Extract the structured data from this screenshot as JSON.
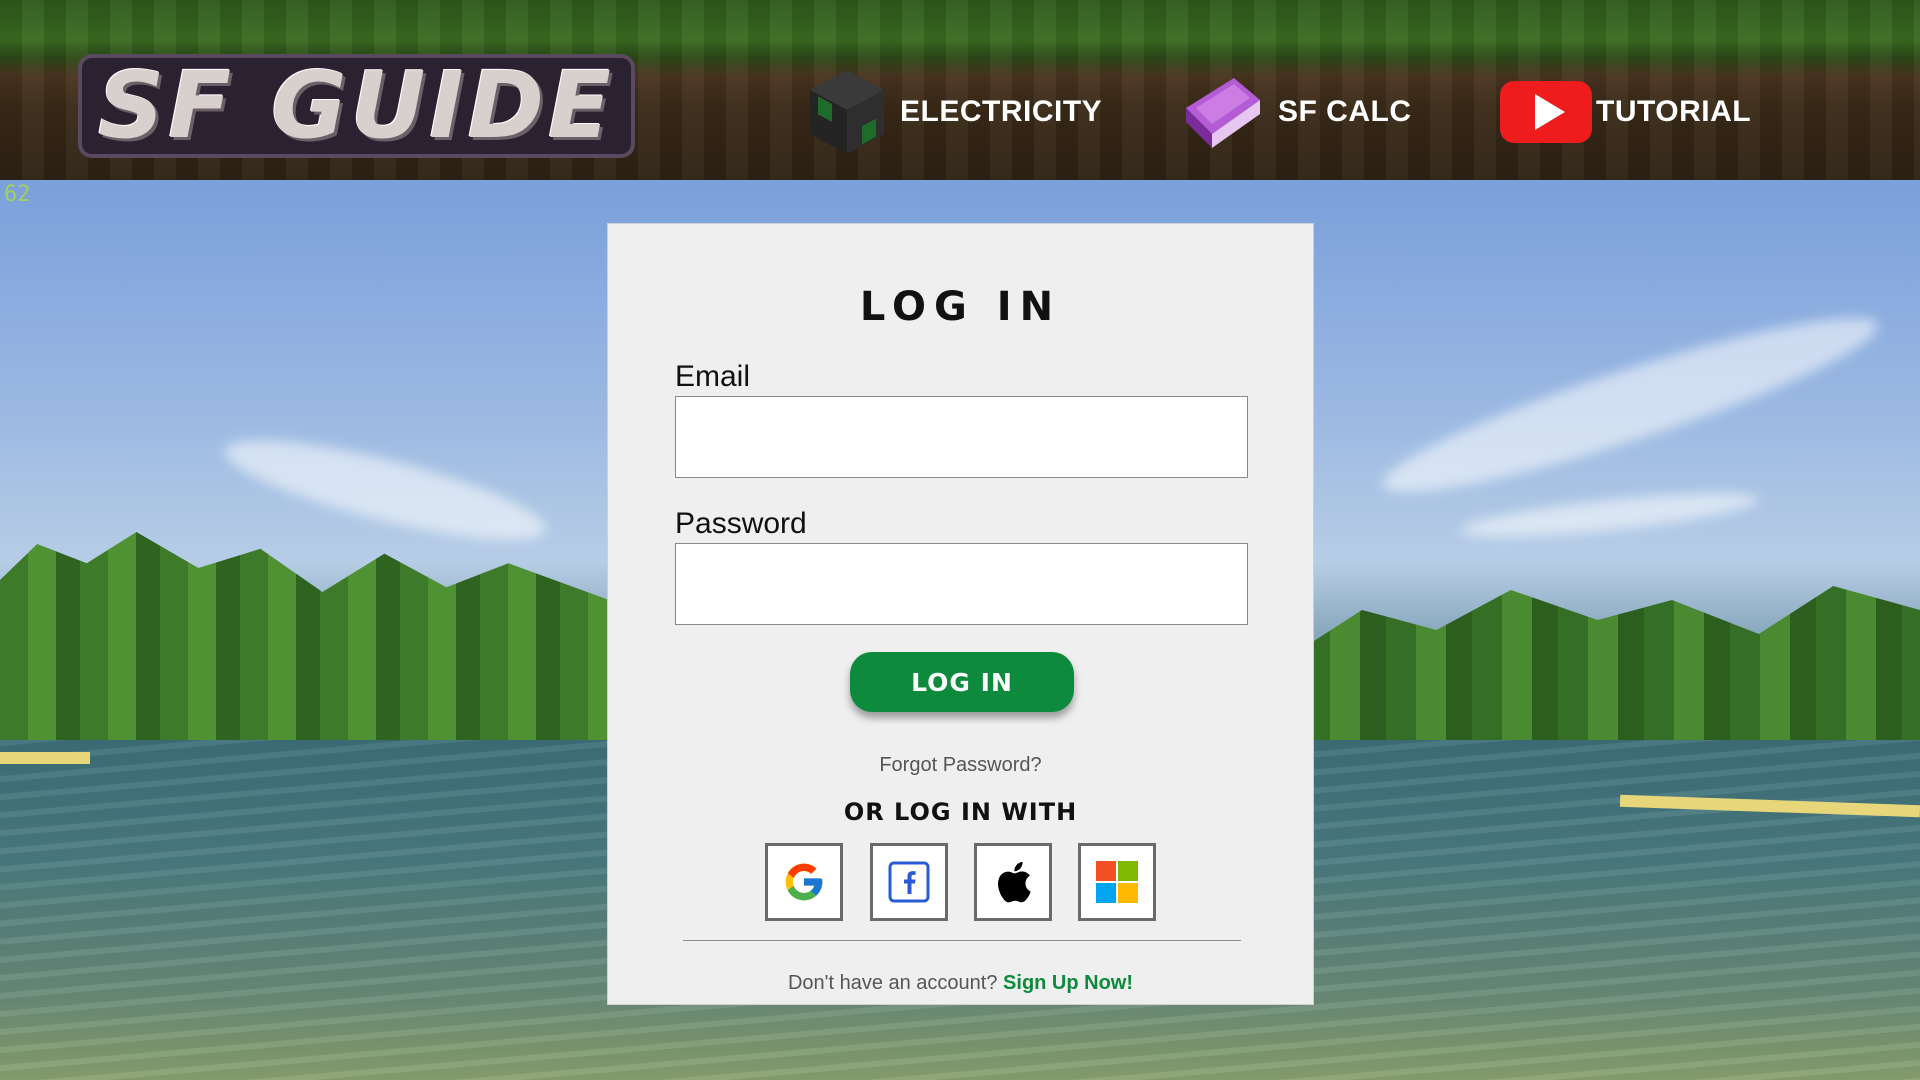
{
  "header": {
    "logo_text": "SF GUIDE",
    "nav": [
      {
        "label": "ELECTRICITY",
        "icon": "machine-block-icon"
      },
      {
        "label": "SF CALC",
        "icon": "enchanted-book-icon"
      },
      {
        "label": "TUTORIAL",
        "icon": "youtube-icon"
      }
    ]
  },
  "fps_counter": "62",
  "login": {
    "title": "LOG IN",
    "email_label": "Email",
    "email_value": "",
    "password_label": "Password",
    "password_value": "",
    "submit_label": "LOG IN",
    "forgot_label": "Forgot Password?",
    "or_label": "OR LOG IN WITH",
    "providers": [
      "google-icon",
      "facebook-icon",
      "apple-icon",
      "microsoft-icon"
    ],
    "signup_prompt": "Don't have an account?",
    "signup_link": "Sign Up Now!"
  },
  "colors": {
    "accent_green": "#0e8a3c",
    "youtube_red": "#ee1c1c"
  }
}
